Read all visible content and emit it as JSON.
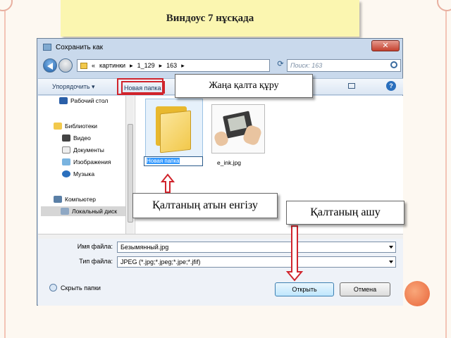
{
  "slide": {
    "title": "Виндоус 7 нұсқада"
  },
  "dialog": {
    "title": "Сохранить как",
    "address": {
      "parts": [
        "«",
        "картинки",
        "▸",
        "1_129",
        "▸",
        "163",
        "▸"
      ]
    },
    "search_placeholder": "Поиск: 163",
    "toolbar": {
      "organize_label": "Упорядочить ▾",
      "new_folder_label": "Новая папка",
      "help_label": "?"
    },
    "nav": [
      {
        "label": "Рабочий стол",
        "icon": "desktop-icon"
      },
      {
        "label": "Библиотеки",
        "icon": "library-icon"
      },
      {
        "label": "Видео",
        "icon": "video-icon"
      },
      {
        "label": "Документы",
        "icon": "documents-icon"
      },
      {
        "label": "Изображения",
        "icon": "images-icon"
      },
      {
        "label": "Музыка",
        "icon": "music-icon"
      },
      {
        "label": "Компьютер",
        "icon": "computer-icon"
      },
      {
        "label": "Локальный диск",
        "icon": "drive-icon"
      }
    ],
    "files": {
      "new_folder_name": "Новая папка",
      "image_name": "e_ink.jpg"
    },
    "filename_label": "Имя файла:",
    "filename_value": "Безымянный.jpg",
    "filetype_label": "Тип файла:",
    "filetype_value": "JPEG (*.jpg;*.jpeg;*.jpe;*.jfif)",
    "hide_folders_label": "Скрыть папки",
    "open_button": "Открыть",
    "cancel_button": "Отмена",
    "close_label": "✕"
  },
  "callouts": {
    "new_folder": "Жаңа қалта құру",
    "enter_name": "Қалтаның атын енгізу",
    "open_folder": "Қалтаның ашу"
  },
  "colors": {
    "accent_red": "#d0242c",
    "slide_title_bg": "#fbf6b0"
  }
}
